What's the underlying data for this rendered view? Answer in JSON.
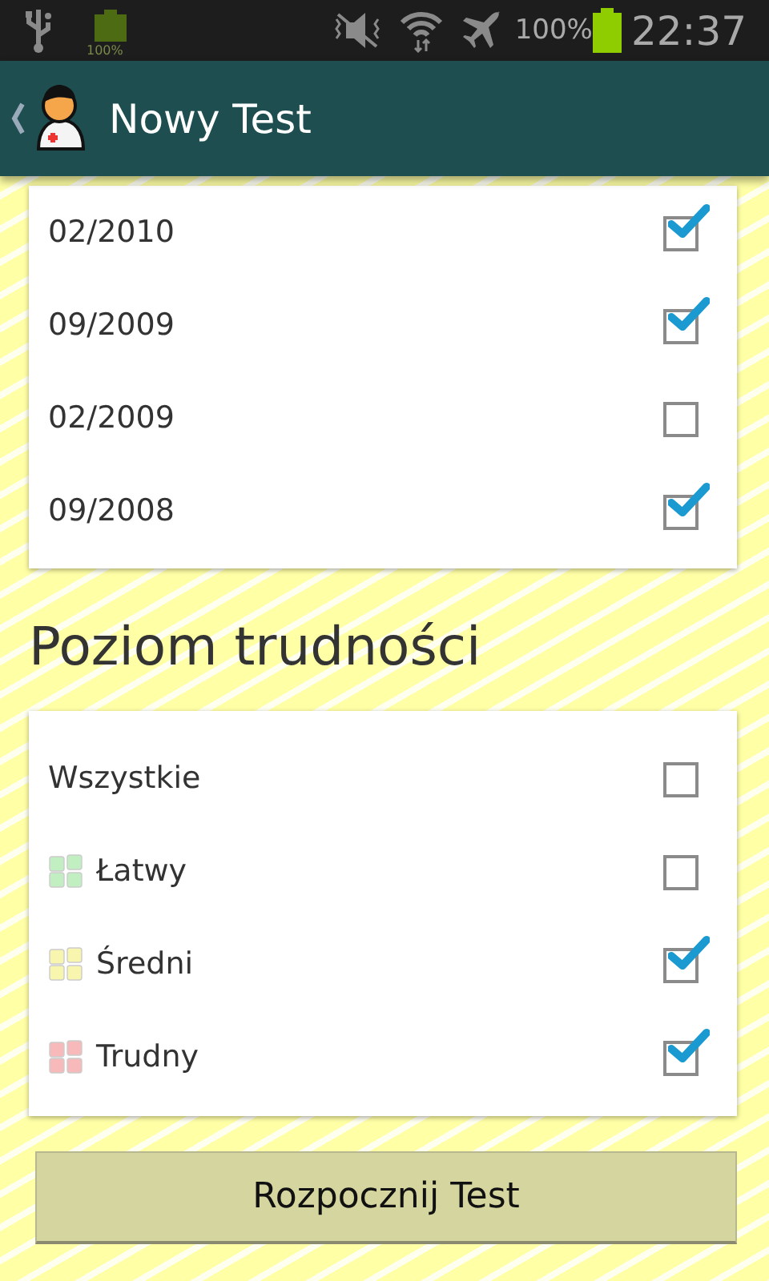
{
  "status_bar": {
    "small_battery_label": "100%",
    "battery_percent": "100%",
    "time": "22:37"
  },
  "app_bar": {
    "title": "Nowy Test"
  },
  "sessions": [
    {
      "label": "02/2010",
      "checked": true
    },
    {
      "label": "09/2009",
      "checked": true
    },
    {
      "label": "02/2009",
      "checked": false
    },
    {
      "label": "09/2008",
      "checked": true
    }
  ],
  "difficulty": {
    "heading": "Poziom trudności",
    "items": [
      {
        "label": "Wszystkie",
        "checked": false
      },
      {
        "label": "Łatwy",
        "color": "#c2efc2",
        "checked": false
      },
      {
        "label": "Średni",
        "color": "#f8f6ae",
        "checked": true
      },
      {
        "label": "Trudny",
        "color": "#f7b9b9",
        "checked": true
      }
    ]
  },
  "start_button": "Rozpocznij Test"
}
